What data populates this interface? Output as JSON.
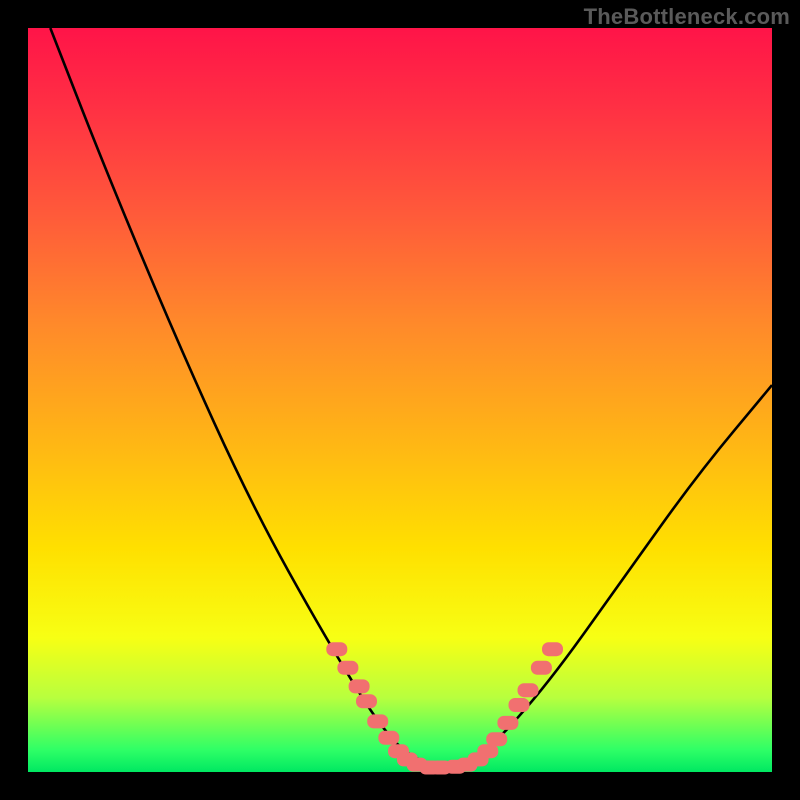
{
  "watermark": "TheBottleneck.com",
  "colors": {
    "background": "#000000",
    "gradient_top": "#ff1448",
    "gradient_mid": "#ffe000",
    "gradient_bottom": "#00e862",
    "curve_stroke": "#000000",
    "marker_fill": "#f17070",
    "marker_stroke": "#f17070"
  },
  "chart_data": {
    "type": "line",
    "title": "",
    "xlabel": "",
    "ylabel": "",
    "xlim": [
      0,
      1
    ],
    "ylim": [
      0,
      1
    ],
    "series": [
      {
        "name": "bottleneck-curve",
        "x": [
          0.03,
          0.1,
          0.2,
          0.3,
          0.4,
          0.48,
          0.53,
          0.58,
          0.62,
          0.7,
          0.8,
          0.9,
          1.0
        ],
        "y": [
          1.0,
          0.82,
          0.58,
          0.36,
          0.18,
          0.05,
          0.01,
          0.01,
          0.03,
          0.12,
          0.26,
          0.4,
          0.52
        ]
      }
    ],
    "markers": {
      "name": "highlighted-points",
      "shape": "rounded-rect",
      "points": [
        {
          "x": 0.415,
          "y": 0.165
        },
        {
          "x": 0.43,
          "y": 0.14
        },
        {
          "x": 0.445,
          "y": 0.115
        },
        {
          "x": 0.455,
          "y": 0.095
        },
        {
          "x": 0.47,
          "y": 0.068
        },
        {
          "x": 0.485,
          "y": 0.046
        },
        {
          "x": 0.498,
          "y": 0.028
        },
        {
          "x": 0.51,
          "y": 0.017
        },
        {
          "x": 0.523,
          "y": 0.01
        },
        {
          "x": 0.54,
          "y": 0.006
        },
        {
          "x": 0.555,
          "y": 0.006
        },
        {
          "x": 0.575,
          "y": 0.007
        },
        {
          "x": 0.59,
          "y": 0.01
        },
        {
          "x": 0.605,
          "y": 0.017
        },
        {
          "x": 0.618,
          "y": 0.028
        },
        {
          "x": 0.63,
          "y": 0.044
        },
        {
          "x": 0.645,
          "y": 0.066
        },
        {
          "x": 0.66,
          "y": 0.09
        },
        {
          "x": 0.672,
          "y": 0.11
        },
        {
          "x": 0.69,
          "y": 0.14
        },
        {
          "x": 0.705,
          "y": 0.165
        }
      ]
    }
  }
}
